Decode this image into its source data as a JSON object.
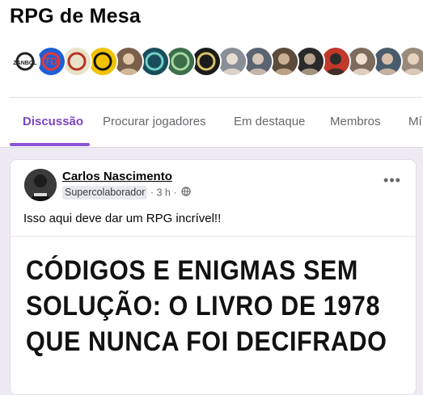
{
  "group": {
    "title": "RPG de Mesa"
  },
  "members_preview": [
    {
      "icon": "logo-avatar-icon",
      "bg": "#ffffff",
      "fg": "#222222",
      "label": "ZANBOL"
    },
    {
      "icon": "logo-avatar-icon",
      "bg": "#1f5fd6",
      "fg": "#e53935",
      "label": "TD"
    },
    {
      "icon": "logo-avatar-icon",
      "bg": "#e8e3c8",
      "fg": "#b83227",
      "label": ""
    },
    {
      "icon": "logo-avatar-icon",
      "bg": "#f2c200",
      "fg": "#111111",
      "label": ""
    },
    {
      "icon": "person-avatar-icon",
      "bg": "#7a5f4a",
      "fg": "#e0c7a8",
      "label": ""
    },
    {
      "icon": "logo-avatar-icon",
      "bg": "#1a4d5c",
      "fg": "#6fd3c8",
      "label": ""
    },
    {
      "icon": "logo-avatar-icon",
      "bg": "#3c6e4a",
      "fg": "#a7d7a0",
      "label": ""
    },
    {
      "icon": "logo-avatar-icon",
      "bg": "#1b1b1b",
      "fg": "#d9c36a",
      "label": ""
    },
    {
      "icon": "person-avatar-icon",
      "bg": "#8a8f97",
      "fg": "#e7ddd2",
      "label": ""
    },
    {
      "icon": "person-avatar-icon",
      "bg": "#5a6472",
      "fg": "#d8c6b6",
      "label": ""
    },
    {
      "icon": "person-avatar-icon",
      "bg": "#5c4a3a",
      "fg": "#cbb193",
      "label": ""
    },
    {
      "icon": "person-avatar-icon",
      "bg": "#2a2a2a",
      "fg": "#b7a58f",
      "label": ""
    },
    {
      "icon": "person-avatar-icon",
      "bg": "#c0392b",
      "fg": "#2b2b2b",
      "label": ""
    },
    {
      "icon": "person-avatar-icon",
      "bg": "#7d6b5d",
      "fg": "#efdfcf",
      "label": ""
    },
    {
      "icon": "person-avatar-icon",
      "bg": "#4a5b6b",
      "fg": "#d9c0a8",
      "label": ""
    },
    {
      "icon": "person-avatar-icon",
      "bg": "#9a8a7a",
      "fg": "#e6d2bf",
      "label": ""
    },
    {
      "icon": "person-avatar-icon",
      "bg": "#3e5266",
      "fg": "#d6b79c",
      "label": ""
    }
  ],
  "tabs": [
    {
      "label": "Discussão",
      "active": true
    },
    {
      "label": "Procurar jogadores",
      "active": false
    },
    {
      "label": "Em destaque",
      "active": false
    },
    {
      "label": "Membros",
      "active": false
    },
    {
      "label": "Mí",
      "active": false
    }
  ],
  "post": {
    "author": "Carlos Nascimento",
    "badge": "Supercolaborador",
    "time": "· 3 h ·",
    "text": "Isso aqui deve dar um RPG incrível!!",
    "image_headline": [
      "CÓDIGOS E ENIGMAS SEM",
      "SOLUÇÃO: O LIVRO DE 1978",
      "QUE NUNCA FOI DECIFRADO"
    ]
  },
  "colors": {
    "accent": "#8a55d6",
    "background": "#eeeaf4"
  }
}
